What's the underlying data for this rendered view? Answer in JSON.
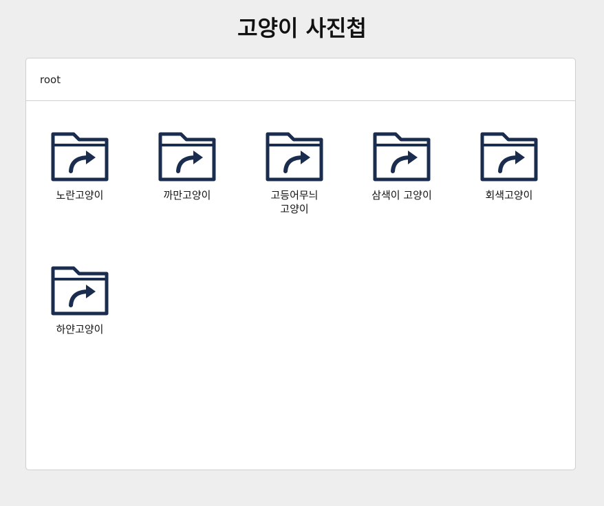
{
  "page": {
    "title": "고양이 사진첩"
  },
  "breadcrumb": {
    "items": [
      "root"
    ]
  },
  "folders": [
    {
      "name": "노란고양이",
      "icon": "folder-shortcut-icon"
    },
    {
      "name": "까만고양이",
      "icon": "folder-shortcut-icon"
    },
    {
      "name": "고등어무늬 고양이",
      "icon": "folder-shortcut-icon"
    },
    {
      "name": "삼색이 고양이",
      "icon": "folder-shortcut-icon"
    },
    {
      "name": "회색고양이",
      "icon": "folder-shortcut-icon"
    },
    {
      "name": "하얀고양이",
      "icon": "folder-shortcut-icon"
    }
  ],
  "colors": {
    "icon": "#1b2d4f",
    "background": "#eeeeee",
    "panel": "#ffffff",
    "border": "#cfcfcf"
  }
}
